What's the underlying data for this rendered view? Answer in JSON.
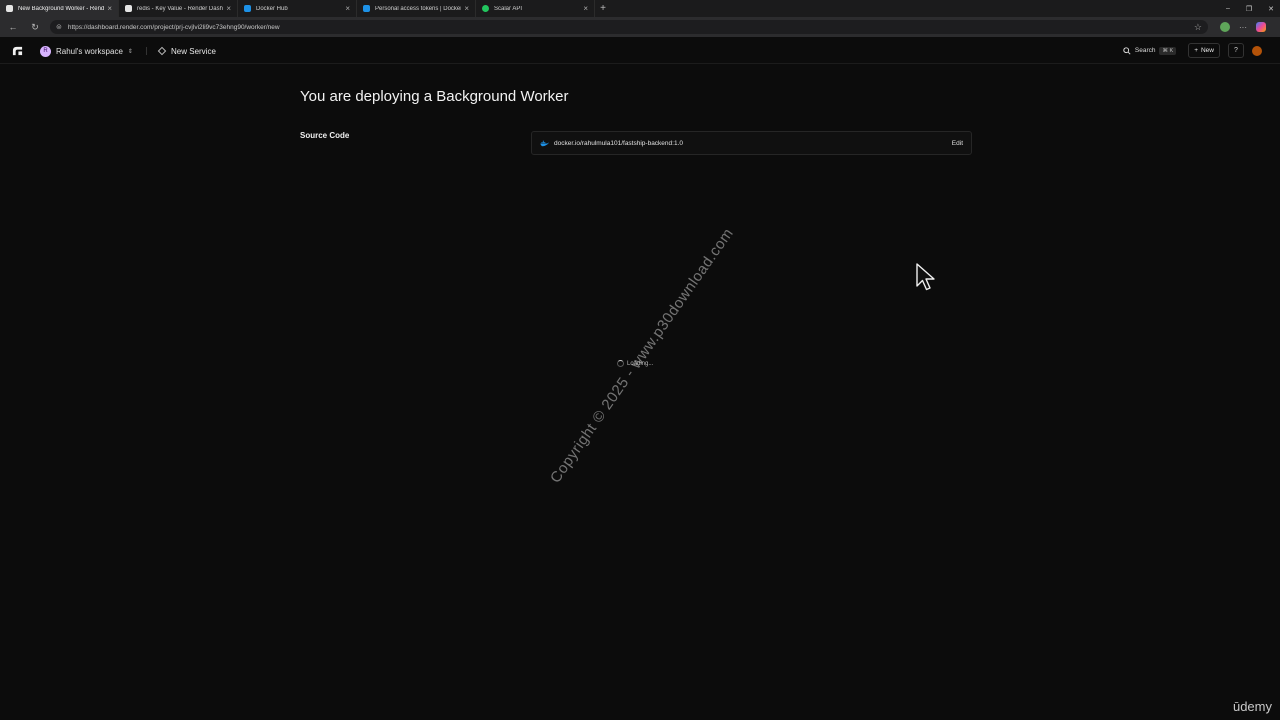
{
  "browser": {
    "tabs": [
      {
        "label": "New Background Worker - Rend",
        "active": true
      },
      {
        "label": "redis - Key Value - Render Dashb",
        "active": false
      },
      {
        "label": "Docker Hub",
        "active": false
      },
      {
        "label": "Personal access tokens | Docker",
        "active": false
      },
      {
        "label": "Scalar API",
        "active": false
      }
    ],
    "tab_close": "×",
    "new_tab": "+",
    "win_min": "–",
    "win_max": "❐",
    "win_close": "✕",
    "nav_back": "←",
    "nav_reload": "↻",
    "url": "https://dashboard.render.com/project/prj-cvjlvi2li9vc73ehng90/worker/new"
  },
  "header": {
    "workspace_initial": "R",
    "workspace": "Rahul's workspace",
    "breadcrumb": "New Service",
    "search_label": "Search",
    "search_shortcut": "⌘ K",
    "new_label": "New",
    "help": "?"
  },
  "main": {
    "title": "You are deploying a Background Worker",
    "source_label": "Source Code",
    "source_value": "docker.io/rahulmula101/fastship-backend:1.0",
    "edit_label": "Edit",
    "loading_text": "Loading..."
  },
  "overlay": {
    "watermark": "Copyright © 2025 - www.p30download.com",
    "brand": "ūdemy"
  },
  "colors": {
    "page_bg": "#0c0c0c",
    "docker_blue": "#1d91e6",
    "workspace_avatar": "#d8b4fe"
  }
}
